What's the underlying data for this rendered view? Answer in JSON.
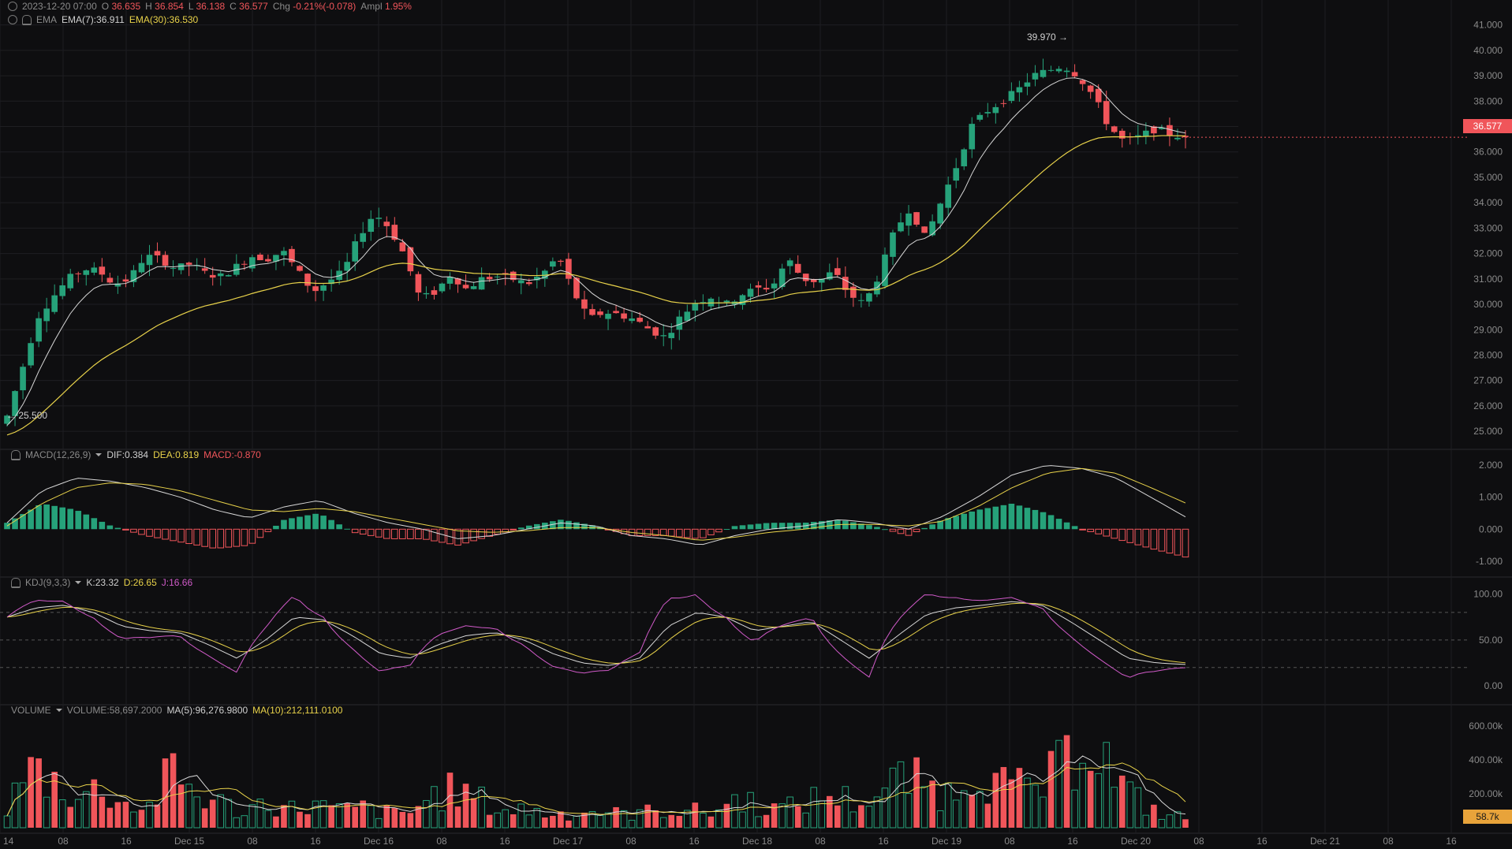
{
  "header": {
    "date": "2023-12-20 07:00",
    "o_label": "O",
    "o": "36.635",
    "h_label": "H",
    "h": "36.854",
    "l_label": "L",
    "l": "36.138",
    "c_label": "C",
    "c": "36.577",
    "chg_label": "Chg",
    "chg": "-0.21%(-0.078)",
    "ampl_label": "Ampl",
    "ampl": "1.95%",
    "ema_label": "EMA",
    "ema7": "EMA(7):36.911",
    "ema30": "EMA(30):36.530"
  },
  "macd_header": {
    "label": "MACD(12,26,9)",
    "dif": "DIF:0.384",
    "dea": "DEA:0.819",
    "macd": "MACD:-0.870"
  },
  "kdj_header": {
    "label": "KDJ(9,3,3)",
    "k": "K:23.32",
    "d": "D:26.65",
    "j": "J:16.66"
  },
  "volume_header": {
    "label": "VOLUME",
    "volume": "VOLUME:58,697.2000",
    "ma5": "MA(5):96,276.9800",
    "ma10": "MA(10):212,111.0100"
  },
  "badges": {
    "price": "36.577",
    "volume": "58.7k"
  },
  "annotations": {
    "high": "39.970 →",
    "low": "← 25.500"
  },
  "colors": {
    "up": "#26a27a",
    "down": "#f0555a",
    "ema7": "#d8d8d8",
    "ema30": "#e8d24a",
    "j": "#d05ac8",
    "grid": "#1e1e22",
    "text": "#8a8a8a",
    "badge_volume": "#e8a33a"
  },
  "chart_data": [
    {
      "type": "candlestick",
      "title": "",
      "x_ticks": [
        "14",
        "08",
        "16",
        "Dec 15",
        "08",
        "16",
        "Dec 16",
        "08",
        "16",
        "Dec 17",
        "08",
        "16",
        "Dec 18",
        "08",
        "16",
        "Dec 19",
        "08",
        "16",
        "Dec 20",
        "08",
        "16",
        "Dec 21",
        "08",
        "16"
      ],
      "y_ticks": [
        "41.000",
        "40.000",
        "39.000",
        "38.000",
        "37.000",
        "36.000",
        "35.000",
        "34.000",
        "33.000",
        "32.000",
        "31.000",
        "30.000",
        "29.000",
        "28.000",
        "27.000",
        "26.000",
        "25.000"
      ],
      "ylim": [
        24.6,
        41.3
      ],
      "bars_every_hours": 1,
      "approx_close_path": [
        25.6,
        27.5,
        29.5,
        30.3,
        31.0,
        31.4,
        31.3,
        30.8,
        31.0,
        31.9,
        31.8,
        31.4,
        31.6,
        31.2,
        31.1,
        31.5,
        31.9,
        31.8,
        32.1,
        31.3,
        30.5,
        30.9,
        31.3,
        32.7,
        33.6,
        33.0,
        31.9,
        30.2,
        30.5,
        31.2,
        30.6,
        31.0,
        31.1,
        31.0,
        30.8,
        31.2,
        31.9,
        30.5,
        29.4,
        29.7,
        29.6,
        29.4,
        29.0,
        28.7,
        29.5,
        30.1,
        30.3,
        30.0,
        30.4,
        30.6,
        30.7,
        31.8,
        31.0,
        30.9,
        31.3,
        30.4,
        30.0,
        31.2,
        32.9,
        33.8,
        32.6,
        34.0,
        35.4,
        37.0,
        37.6,
        38.0,
        38.4,
        39.0,
        39.2,
        39.4,
        39.0,
        38.2,
        37.0,
        36.4,
        36.6,
        36.9,
        36.7,
        36.58
      ],
      "last": {
        "open": 36.635,
        "high": 36.854,
        "low": 36.138,
        "close": 36.577
      },
      "high_marker": 39.97,
      "low_marker": 25.5,
      "series": [
        {
          "name": "EMA(7)",
          "last": 36.911
        },
        {
          "name": "EMA(30)",
          "last": 36.53
        }
      ]
    },
    {
      "type": "macd",
      "y_ticks": [
        "2.000",
        "1.000",
        "0.000",
        "-1.000"
      ],
      "ylim": [
        -1.25,
        2.25
      ],
      "approx_dif_path": [
        0.2,
        1.2,
        1.6,
        1.5,
        1.3,
        1.0,
        0.6,
        0.35,
        0.7,
        0.9,
        0.5,
        0.2,
        0.0,
        -0.3,
        -0.2,
        0.0,
        0.2,
        0.1,
        -0.2,
        -0.3,
        -0.5,
        -0.2,
        0.0,
        0.1,
        0.3,
        0.2,
        0.0,
        0.4,
        1.0,
        1.7,
        2.0,
        1.9,
        1.6,
        1.0,
        0.384
      ],
      "approx_dea_path": [
        0.1,
        0.8,
        1.3,
        1.45,
        1.4,
        1.2,
        0.9,
        0.6,
        0.55,
        0.65,
        0.55,
        0.35,
        0.15,
        -0.05,
        -0.1,
        -0.05,
        0.05,
        0.05,
        -0.1,
        -0.2,
        -0.35,
        -0.25,
        -0.1,
        0.0,
        0.15,
        0.15,
        0.1,
        0.25,
        0.7,
        1.3,
        1.75,
        1.9,
        1.75,
        1.3,
        0.819
      ],
      "series": [
        {
          "name": "DIF",
          "last": 0.384
        },
        {
          "name": "DEA",
          "last": 0.819
        },
        {
          "name": "MACD",
          "last": -0.87
        }
      ]
    },
    {
      "type": "kdj",
      "y_ticks": [
        "100.00",
        "50.00",
        "0.00"
      ],
      "ylim": [
        -12,
        110
      ],
      "reference_lines": [
        80,
        50,
        20
      ],
      "approx_k_path": [
        75,
        85,
        88,
        80,
        65,
        60,
        58,
        45,
        30,
        50,
        75,
        72,
        55,
        35,
        30,
        45,
        55,
        58,
        50,
        35,
        25,
        22,
        30,
        65,
        80,
        75,
        60,
        65,
        70,
        50,
        30,
        55,
        78,
        85,
        88,
        92,
        88,
        70,
        50,
        30,
        25,
        23.32
      ],
      "series": [
        {
          "name": "K",
          "last": 23.32
        },
        {
          "name": "D",
          "last": 26.65
        },
        {
          "name": "J",
          "last": 16.66
        }
      ]
    },
    {
      "type": "bar",
      "y_ticks": [
        "600.00k",
        "400.00k",
        "200.00k"
      ],
      "ylim": [
        0,
        680000
      ],
      "approx_volume_path": [
        120000,
        350000,
        280000,
        180000,
        240000,
        140000,
        120000,
        330000,
        200000,
        150000,
        90000,
        160000,
        110000,
        140000,
        100000,
        120000,
        90000,
        80000,
        190000,
        220000,
        170000,
        100000,
        110000,
        80000,
        90000,
        100000,
        80000,
        90000,
        110000,
        100000,
        90000,
        180000,
        130000,
        110000,
        160000,
        200000,
        150000,
        190000,
        300000,
        250000,
        200000,
        380000,
        260000,
        230000,
        250000,
        400000,
        600000,
        280000,
        160000,
        80000,
        58697
      ],
      "series": [
        {
          "name": "VOLUME",
          "last": 58697.2
        },
        {
          "name": "MA(5)",
          "last": 96276.98
        },
        {
          "name": "MA(10)",
          "last": 212111.01
        }
      ]
    }
  ]
}
